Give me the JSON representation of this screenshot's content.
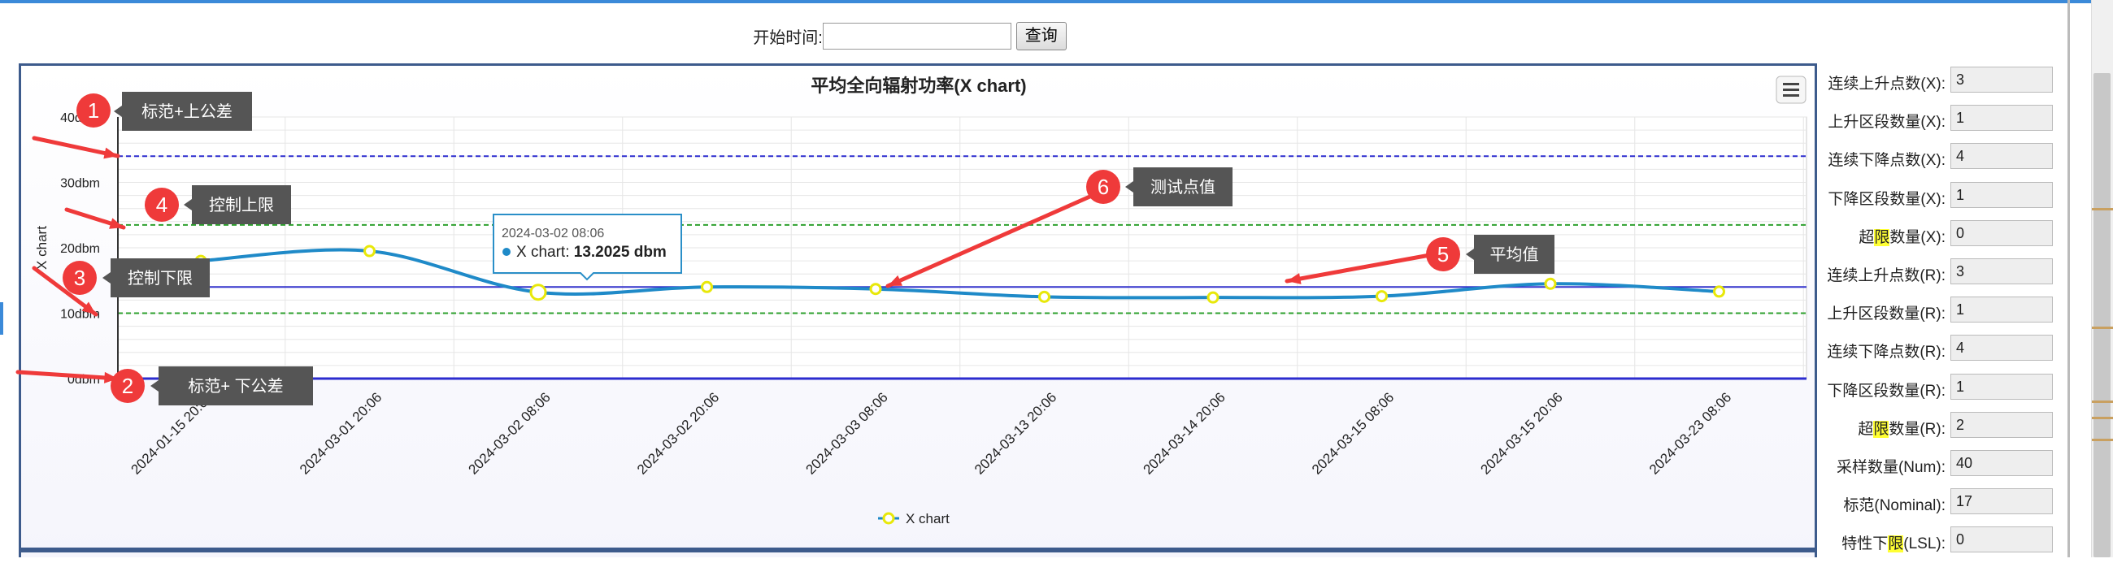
{
  "search": {
    "label": "开始时间:",
    "value": "",
    "button": "查询"
  },
  "chart_data": {
    "type": "line",
    "title": "平均全向辐射功率(X chart)",
    "ylabel": "X chart",
    "categories": [
      "2024-01-15 20:06",
      "2024-03-01 20:06",
      "2024-03-02 08:06",
      "2024-03-02 20:06",
      "2024-03-03 08:06",
      "2024-03-13 20:06",
      "2024-03-14 20:06",
      "2024-03-15 08:06",
      "2024-03-15 20:06",
      "2024-03-23 08:06"
    ],
    "y_ticks": [
      "0dbm",
      "10dbm",
      "20dbm",
      "30dbm",
      "40dbm"
    ],
    "ylim": [
      0,
      40
    ],
    "series": [
      {
        "name": "X chart",
        "values": [
          18,
          19.5,
          13.2,
          14.0,
          13.7,
          12.5,
          12.4,
          12.6,
          14.5,
          13.3
        ],
        "color": "#1f8ac8"
      }
    ],
    "reference_lines": {
      "usl": 34,
      "ucl": 23.5,
      "mean": 14,
      "lcl": 10,
      "lsl": 0
    },
    "tooltip": {
      "date": "2024-03-02 08:06",
      "series": "X chart: ",
      "value": "13.2025 dbm"
    },
    "annotations": [
      {
        "num": "1",
        "text": "标范+上公差"
      },
      {
        "num": "2",
        "text": "标范+ 下公差"
      },
      {
        "num": "3",
        "text": "控制下限"
      },
      {
        "num": "4",
        "text": "控制上限"
      },
      {
        "num": "5",
        "text": "平均值"
      },
      {
        "num": "6",
        "text": "测试点值"
      }
    ],
    "legend": "X chart",
    "legend_position": "bottom",
    "grid": true
  },
  "stats": [
    {
      "pre": "连续上升点数(X):",
      "hl": "",
      "post": "",
      "value": "3"
    },
    {
      "pre": "上升区段数量(X):",
      "hl": "",
      "post": "",
      "value": "1"
    },
    {
      "pre": "连续下降点数(X):",
      "hl": "",
      "post": "",
      "value": "4"
    },
    {
      "pre": "下降区段数量(X):",
      "hl": "",
      "post": "",
      "value": "1"
    },
    {
      "pre": "超",
      "hl": "限",
      "post": "数量(X):",
      "value": "0"
    },
    {
      "pre": "连续上升点数(R):",
      "hl": "",
      "post": "",
      "value": "3"
    },
    {
      "pre": "上升区段数量(R):",
      "hl": "",
      "post": "",
      "value": "1"
    },
    {
      "pre": "连续下降点数(R):",
      "hl": "",
      "post": "",
      "value": "4"
    },
    {
      "pre": "下降区段数量(R):",
      "hl": "",
      "post": "",
      "value": "1"
    },
    {
      "pre": "超",
      "hl": "限",
      "post": "数量(R):",
      "value": "2"
    },
    {
      "pre": "采样数量(Num):",
      "hl": "",
      "post": "",
      "value": "40"
    },
    {
      "pre": "标范(Nominal):",
      "hl": "",
      "post": "",
      "value": "17"
    },
    {
      "pre": "特性下",
      "hl": "限",
      "post": "(LSL):",
      "value": "0"
    }
  ]
}
